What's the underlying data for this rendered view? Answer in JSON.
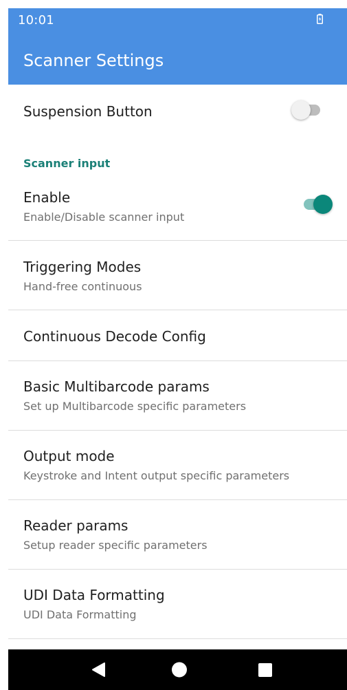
{
  "status_bar": {
    "time": "10:01",
    "battery_icon": "battery-charging-icon"
  },
  "app_bar": {
    "title": "Scanner Settings",
    "color": "#4a8fe2"
  },
  "rows": {
    "suspension": {
      "title": "Suspension Button",
      "switch_on": false
    },
    "section_header": "Scanner input",
    "enable": {
      "title": "Enable",
      "subtitle": "Enable/Disable scanner input",
      "switch_on": true
    },
    "triggering": {
      "title": "Triggering Modes",
      "subtitle": "Hand-free continuous"
    },
    "continuous": {
      "title": "Continuous Decode Config"
    },
    "multibarcode": {
      "title": "Basic Multibarcode params",
      "subtitle": "Set up Multibarcode specific parameters"
    },
    "output": {
      "title": "Output mode",
      "subtitle": "Keystroke and Intent output specific parameters"
    },
    "reader": {
      "title": "Reader params",
      "subtitle": "Setup reader specific parameters"
    },
    "udi": {
      "title": "UDI Data Formatting",
      "subtitle": "UDI Data Formatting"
    }
  },
  "nav_bar": {
    "back_icon": "back-triangle-icon",
    "home_icon": "home-circle-icon",
    "recents_icon": "recents-square-icon"
  },
  "colors": {
    "accent": "#0b877a",
    "section_header": "#1b8077"
  }
}
